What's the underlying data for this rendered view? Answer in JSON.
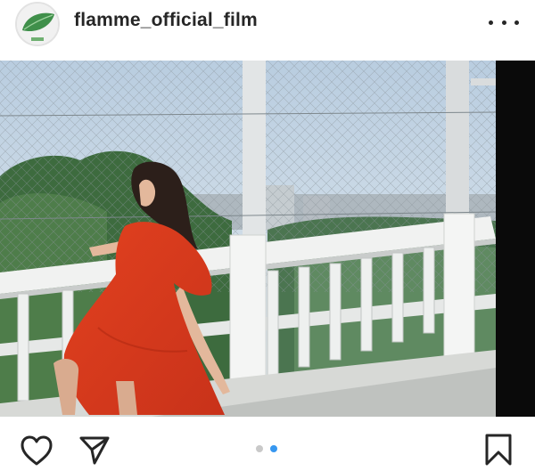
{
  "post": {
    "username": "flamme_official_film"
  },
  "carousel": {
    "count": 2,
    "active_index": 1,
    "active_color": "#3797f0",
    "inactive_color": "#c9c9c9"
  },
  "icons": {
    "more": "more-horizontal-icon",
    "like": "heart-outline-icon",
    "share": "paper-plane-icon",
    "save": "bookmark-outline-icon"
  }
}
